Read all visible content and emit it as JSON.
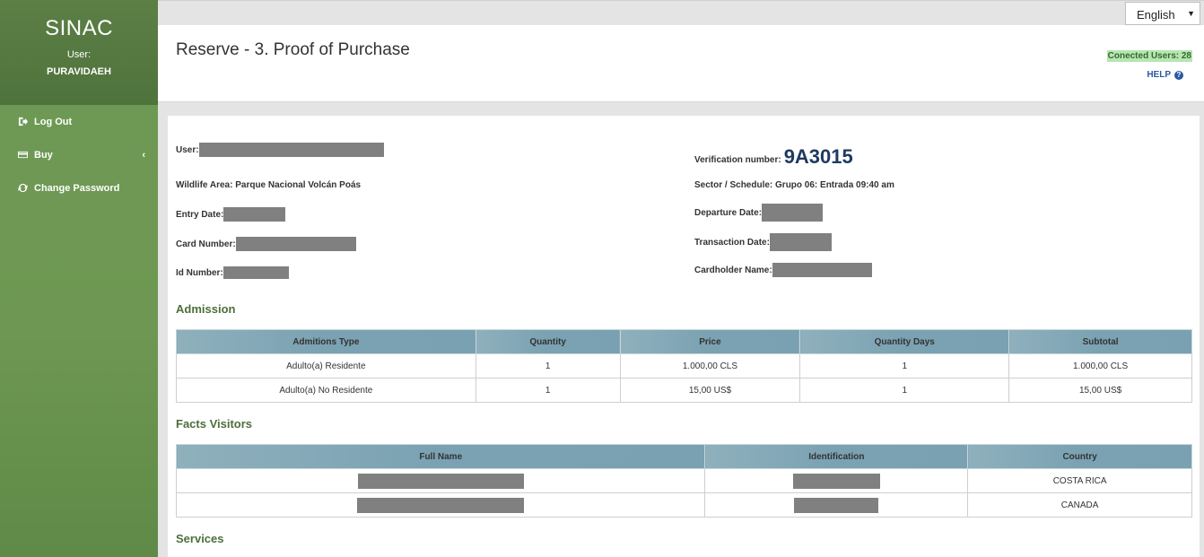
{
  "sidebar": {
    "app_title": "SINAC",
    "user_label": "User:",
    "user_name": "PURAVIDAEH",
    "items": [
      {
        "label": "Log Out",
        "icon": "sign-out-icon"
      },
      {
        "label": "Buy",
        "icon": "credit-card-icon",
        "chevron": "‹"
      },
      {
        "label": "Change Password",
        "icon": "refresh-icon"
      }
    ]
  },
  "topbar": {
    "language": "English",
    "language_arrow": "▼"
  },
  "header": {
    "title": "Reserve - 3. Proof of Purchase",
    "connected_users": "Conected Users: 28",
    "help": "HELP",
    "help_icon_glyph": "?"
  },
  "details": {
    "user_label": "User:",
    "verification_label": "Verification number:",
    "verification_number": "9A3015",
    "wildlife_area": "Wildlife Area: Parque Nacional Volcán Poás",
    "sector_schedule": "Sector / Schedule: Grupo 06: Entrada 09:40 am",
    "entry_date_label": "Entry Date:",
    "departure_date_label": "Departure Date:",
    "card_number_label": "Card Number:",
    "transaction_date_label": "Transaction Date:",
    "id_number_label": "Id Number:",
    "cardholder_name_label": "Cardholder Name:"
  },
  "admission": {
    "title": "Admission",
    "headers": [
      "Admitions Type",
      "Quantity",
      "Price",
      "Quantity Days",
      "Subtotal"
    ],
    "rows": [
      [
        "Adulto(a) Residente",
        "1",
        "1.000,00 CLS",
        "1",
        "1.000,00 CLS"
      ],
      [
        "Adulto(a) No Residente",
        "1",
        "15,00 US$",
        "1",
        "15,00 US$"
      ]
    ]
  },
  "visitors": {
    "title": "Facts Visitors",
    "headers": [
      "Full Name",
      "Identification",
      "Country"
    ],
    "rows": [
      {
        "country": "COSTA RICA"
      },
      {
        "country": "CANADA"
      }
    ]
  },
  "services": {
    "title": "Services"
  }
}
